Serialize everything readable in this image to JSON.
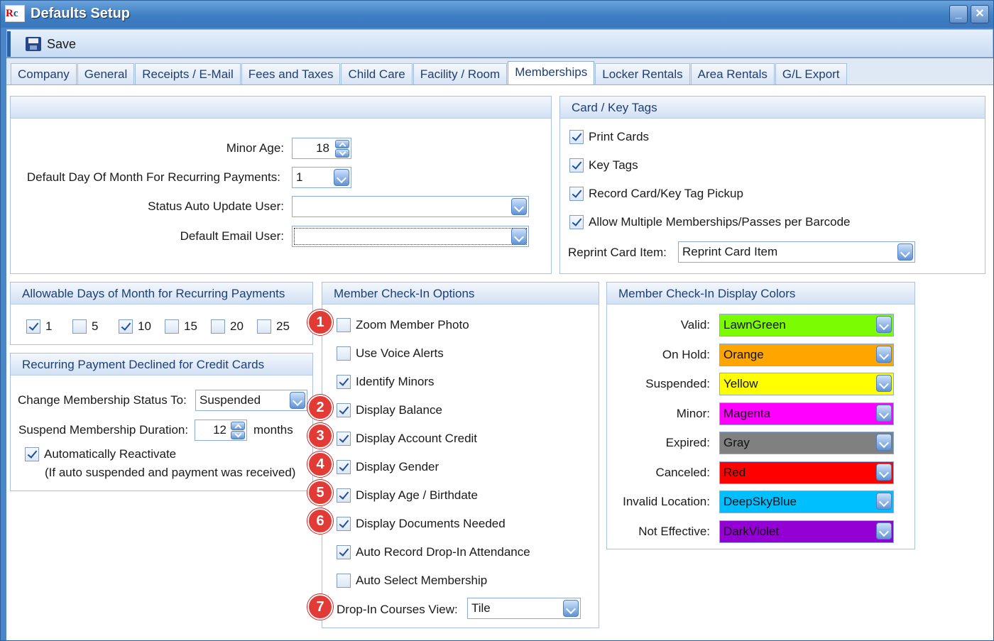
{
  "window": {
    "title": "Defaults Setup",
    "app_icon": "rc-logo-icon",
    "minimize": "_",
    "close": "✕"
  },
  "toolbar": {
    "save_label": "Save",
    "save_icon": "floppy-disk-icon"
  },
  "tabs": [
    "Company",
    "General",
    "Receipts / E-Mail",
    "Fees and Taxes",
    "Child Care",
    "Facility / Room",
    "Memberships",
    "Locker Rentals",
    "Area Rentals",
    "G/L Export"
  ],
  "active_tab": "Memberships",
  "general": {
    "minor_age_label": "Minor Age:",
    "minor_age_value": "18",
    "default_day_label": "Default Day Of Month For Recurring Payments:",
    "default_day_value": "1",
    "status_user_label": "Status Auto Update User:",
    "status_user_value": "",
    "email_user_label": "Default Email User:",
    "email_user_value": ""
  },
  "card_key": {
    "title": "Card / Key Tags",
    "items": [
      {
        "label": "Print Cards",
        "checked": true
      },
      {
        "label": "Key Tags",
        "checked": true
      },
      {
        "label": "Record Card/Key Tag Pickup",
        "checked": true
      },
      {
        "label": "Allow Multiple Memberships/Passes per Barcode",
        "checked": true
      }
    ],
    "reprint_label": "Reprint Card Item:",
    "reprint_value": "Reprint Card Item"
  },
  "allowable_days": {
    "title": "Allowable Days of Month for Recurring Payments",
    "days": [
      {
        "label": "1",
        "checked": true
      },
      {
        "label": "5",
        "checked": false
      },
      {
        "label": "10",
        "checked": true
      },
      {
        "label": "15",
        "checked": false
      },
      {
        "label": "20",
        "checked": false
      },
      {
        "label": "25",
        "checked": false
      }
    ]
  },
  "declined": {
    "title": "Recurring Payment Declined for Credit Cards",
    "status_label": "Change Membership Status To:",
    "status_value": "Suspended",
    "duration_label": "Suspend Membership Duration:",
    "duration_value": "12",
    "duration_unit": "months",
    "reactivate_label": "Automatically Reactivate",
    "reactivate_checked": true,
    "reactivate_note": "(If auto suspended and payment was received)"
  },
  "checkin": {
    "title": "Member Check-In Options",
    "items": [
      {
        "label": "Zoom Member Photo",
        "checked": false,
        "marker": "1"
      },
      {
        "label": "Use Voice Alerts",
        "checked": false,
        "marker": ""
      },
      {
        "label": "Identify Minors",
        "checked": true,
        "marker": ""
      },
      {
        "label": "Display Balance",
        "checked": true,
        "marker": "2"
      },
      {
        "label": "Display Account Credit",
        "checked": true,
        "marker": "3"
      },
      {
        "label": "Display Gender",
        "checked": true,
        "marker": "4"
      },
      {
        "label": "Display Age / Birthdate",
        "checked": true,
        "marker": "5"
      },
      {
        "label": "Display Documents Needed",
        "checked": true,
        "marker": "6"
      },
      {
        "label": "Auto Record Drop-In Attendance",
        "checked": true,
        "marker": ""
      },
      {
        "label": "Auto Select Membership",
        "checked": false,
        "marker": ""
      }
    ],
    "courses_view_label": "Drop-In Courses View:",
    "courses_view_value": "Tile",
    "courses_view_marker": "7"
  },
  "display_colors": {
    "title": "Member Check-In Display Colors",
    "items": [
      {
        "label": "Valid:",
        "value": "LawnGreen",
        "color": "#7CFC00"
      },
      {
        "label": "On Hold:",
        "value": "Orange",
        "color": "#FFA500"
      },
      {
        "label": "Suspended:",
        "value": "Yellow",
        "color": "#FFFF00"
      },
      {
        "label": "Minor:",
        "value": "Magenta",
        "color": "#FF00FF"
      },
      {
        "label": "Expired:",
        "value": "Gray",
        "color": "#808080"
      },
      {
        "label": "Canceled:",
        "value": "Red",
        "color": "#FF0000"
      },
      {
        "label": "Invalid Location:",
        "value": "DeepSkyBlue",
        "color": "#00BFFF"
      },
      {
        "label": "Not Effective:",
        "value": "DarkViolet",
        "color": "#9400D3"
      }
    ]
  }
}
